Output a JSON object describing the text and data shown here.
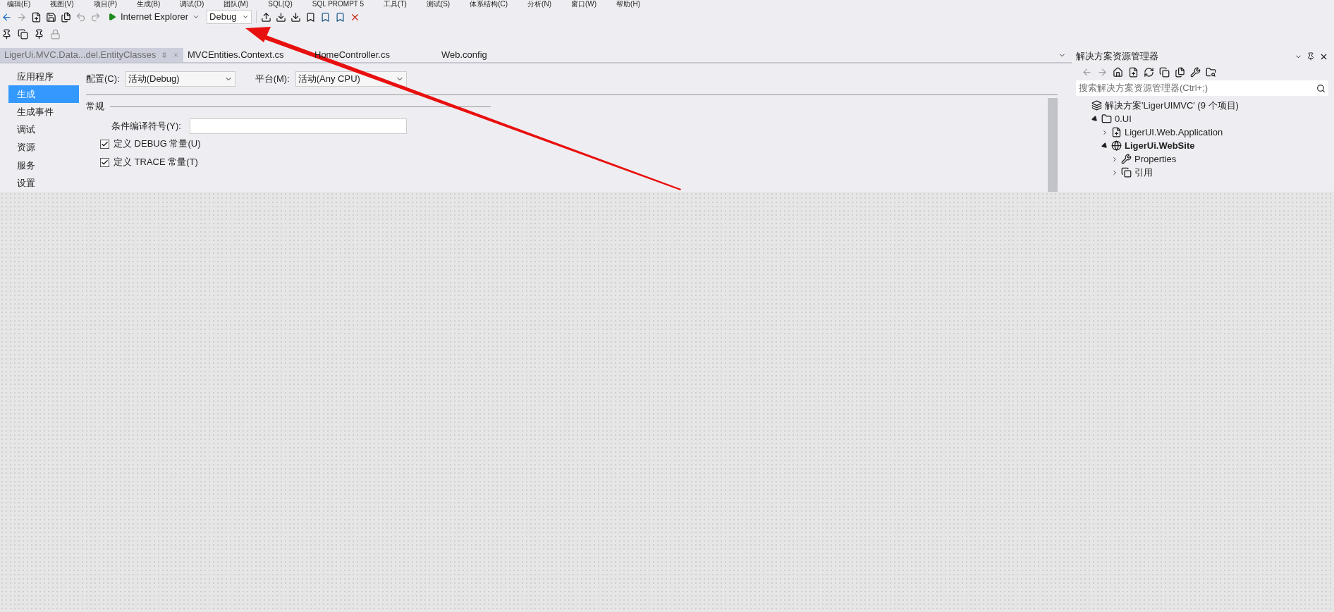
{
  "menu": [
    "编辑(E)",
    "视图(V)",
    "项目(P)",
    "生成(B)",
    "调试(D)",
    "团队(M)",
    "SQL(Q)",
    "SQL PROMPT 5",
    "工具(T)",
    "测试(S)",
    "体系结构(C)",
    "分析(N)",
    "窗口(W)",
    "帮助(H)"
  ],
  "toolbar": {
    "run_target": "Internet Explorer",
    "configuration": "Debug"
  },
  "tabs": [
    {
      "label": "LigerUi.MVC.Data...del.EntityClasses",
      "selected": true
    },
    {
      "label": "MVCEntities.Context.cs",
      "selected": false
    },
    {
      "label": "HomeController.cs",
      "selected": false
    },
    {
      "label": "Web.config",
      "selected": false
    }
  ],
  "nav": [
    {
      "label": "应用程序",
      "selected": false
    },
    {
      "label": "生成",
      "selected": true
    },
    {
      "label": "生成事件",
      "selected": false
    },
    {
      "label": "调试",
      "selected": false
    },
    {
      "label": "资源",
      "selected": false
    },
    {
      "label": "服务",
      "selected": false
    },
    {
      "label": "设置",
      "selected": false
    }
  ],
  "build": {
    "configuration_label": "配置(C):",
    "configuration": "活动(Debug)",
    "platform_label": "平台(M):",
    "platform": "活动(Any CPU)",
    "section": "常规",
    "symbols_label": "条件编译符号(Y):",
    "checkboxes": [
      {
        "label": "定义 DEBUG 常量(U)",
        "checked": true
      },
      {
        "label": "定义 TRACE 常量(T)",
        "checked": true
      }
    ]
  },
  "solution_explorer": {
    "title": "解决方案资源管理器",
    "search_placeholder": "搜索解决方案资源管理器(Ctrl+;)",
    "tree": [
      {
        "label": "解决方案'LigerUIMVC' (9 个项目)",
        "kind": "solution",
        "children": [
          {
            "label": "0.UI",
            "kind": "folder",
            "expanded": true,
            "children": [
              {
                "label": "LigerUI.Web.Application",
                "kind": "csproject",
                "expanded": false,
                "startup": false
              },
              {
                "label": "LigerUi.WebSite",
                "kind": "website",
                "expanded": true,
                "startup": true,
                "children": [
                  {
                    "label": "Properties",
                    "kind": "properties",
                    "expanded": false
                  },
                  {
                    "label": "引用",
                    "kind": "references",
                    "expanded": false
                  }
                ]
              }
            ]
          }
        ]
      }
    ]
  }
}
